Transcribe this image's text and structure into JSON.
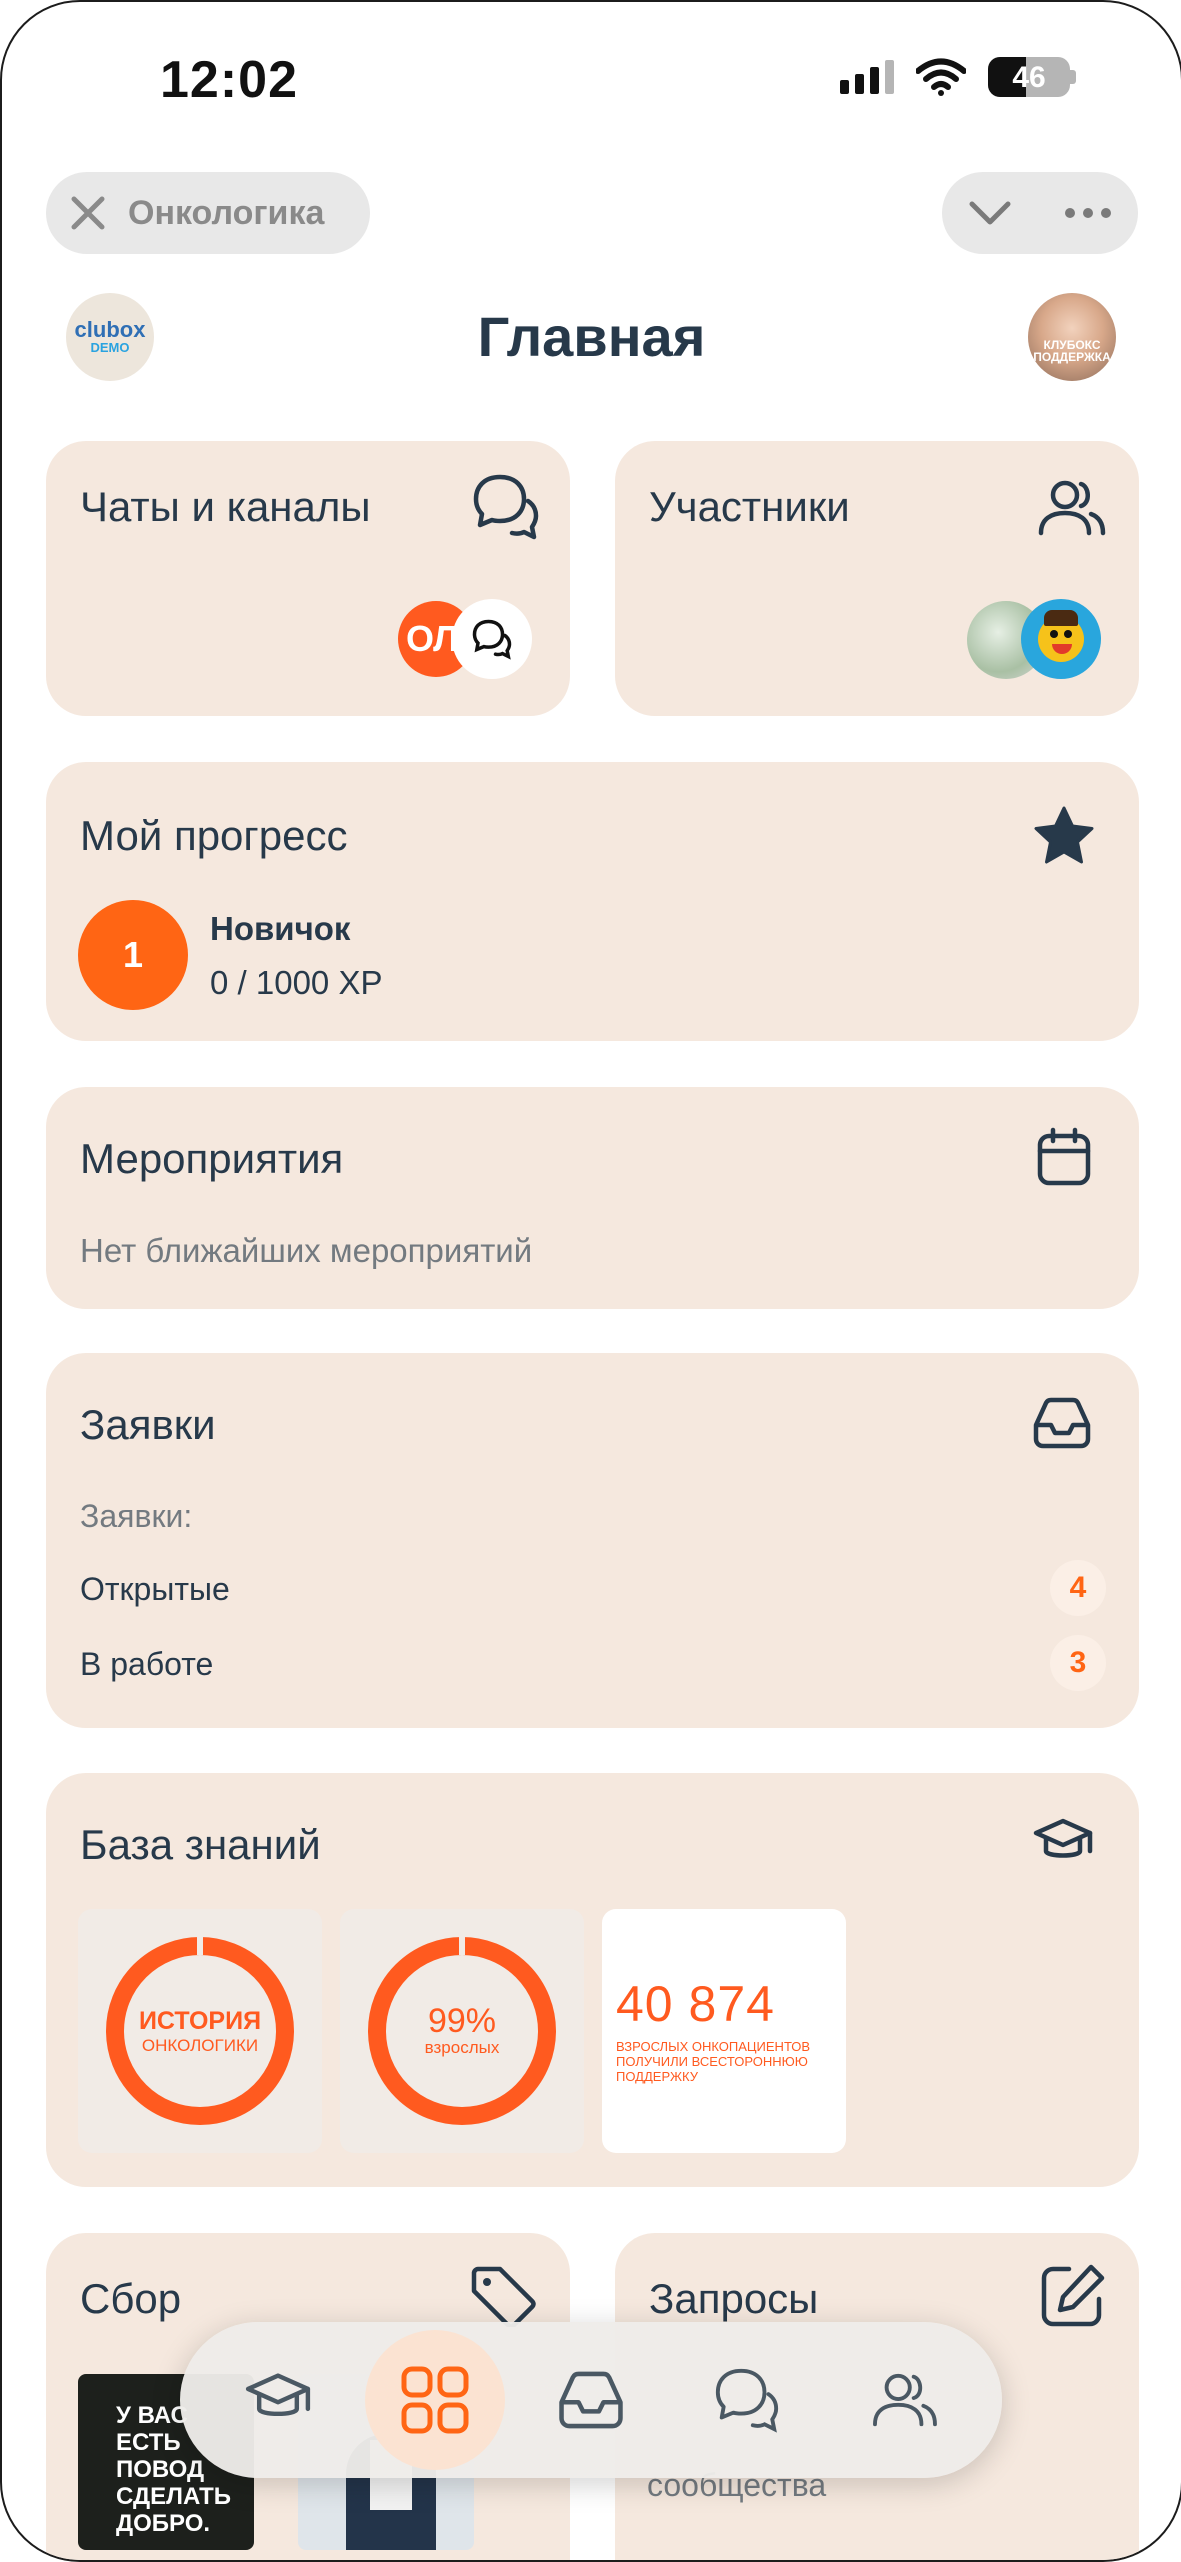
{
  "status_bar": {
    "time": "12:02",
    "battery": "46"
  },
  "top_bar": {
    "close_label": "Онкологика"
  },
  "header": {
    "title": "Главная",
    "logo_line1": "clubox",
    "logo_line2": "DEMO",
    "avatar_text": "КЛУБОКС ПОДДЕРЖКА"
  },
  "cards": {
    "chats": {
      "title": "Чаты и каналы",
      "avatar_text": "ОЛ"
    },
    "members": {
      "title": "Участники"
    },
    "progress": {
      "title": "Мой прогресс",
      "level": "1",
      "rank": "Новичок",
      "xp": "0 / 1000 XP"
    },
    "events": {
      "title": "Мероприятия",
      "empty": "Нет ближайших мероприятий"
    },
    "requests": {
      "title": "Заявки",
      "subtitle": "Заявки:",
      "rows": [
        {
          "label": "Открытые",
          "count": "4"
        },
        {
          "label": "В работе",
          "count": "3"
        }
      ]
    },
    "knowledge": {
      "title": "База знаний",
      "tiles": [
        {
          "big": "ИСТОРИЯ",
          "small": "ОНКОЛОГИКИ"
        },
        {
          "big": "99%",
          "small": "взрослых"
        },
        {
          "big": "40 874",
          "small": "ВЗРОСЛЫХ ОНКОПАЦИЕНТОВ ПОЛУЧИЛИ ВСЕСТОРОННЮЮ ПОДДЕРЖКУ"
        }
      ]
    },
    "fundraising": {
      "title": "Сбор",
      "thumb_text": "У ВАС ЕСТЬ ПОВОД СДЕЛАТЬ ДОБРО."
    },
    "queries": {
      "title": "Запросы",
      "partial_text": "сообщества"
    }
  },
  "bottom_nav": {
    "items": [
      "knowledge-base",
      "home",
      "inbox",
      "chats",
      "members"
    ],
    "active": "home"
  },
  "colors": {
    "accent": "#ff6514",
    "card_bg": "#f5e8de",
    "title_text": "#27394a"
  }
}
